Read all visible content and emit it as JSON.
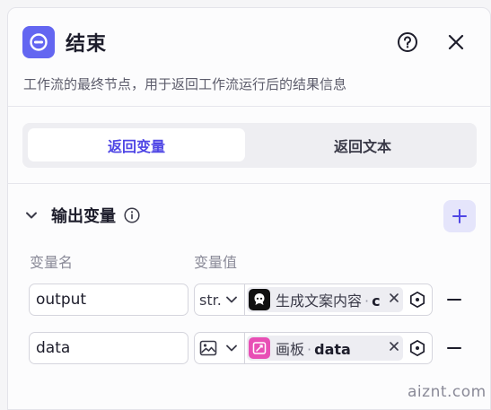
{
  "header": {
    "title": "结束",
    "subtitle": "工作流的最终节点，用于返回工作流运行后的结果信息",
    "logo_icon": "exit-icon",
    "help_icon": "question-circle-icon",
    "close_icon": "close-icon"
  },
  "tabs": [
    {
      "label": "返回变量",
      "active": true
    },
    {
      "label": "返回文本",
      "active": false
    }
  ],
  "output_section": {
    "title": "输出变量",
    "info_icon": "info-icon",
    "add_icon": "plus-icon",
    "columns": {
      "name": "变量名",
      "value": "变量值"
    },
    "rows": [
      {
        "name": "output",
        "type_label": "str.",
        "ref_node": "生成文案内容",
        "ref_var": "c",
        "ref_icon": "chat-bot-icon",
        "ref_icon_color": "#111111"
      },
      {
        "name": "data",
        "type_label": "",
        "type_icon": "image-icon",
        "ref_node": "画板",
        "ref_var": "data",
        "ref_icon": "canvas-icon",
        "ref_icon_color": "#e84fb5"
      }
    ]
  },
  "watermark": "aiznt.com",
  "colors": {
    "accent": "#4f46e5",
    "logo_bg": "#6366f1",
    "add_button_bg": "#e5e5fb"
  }
}
